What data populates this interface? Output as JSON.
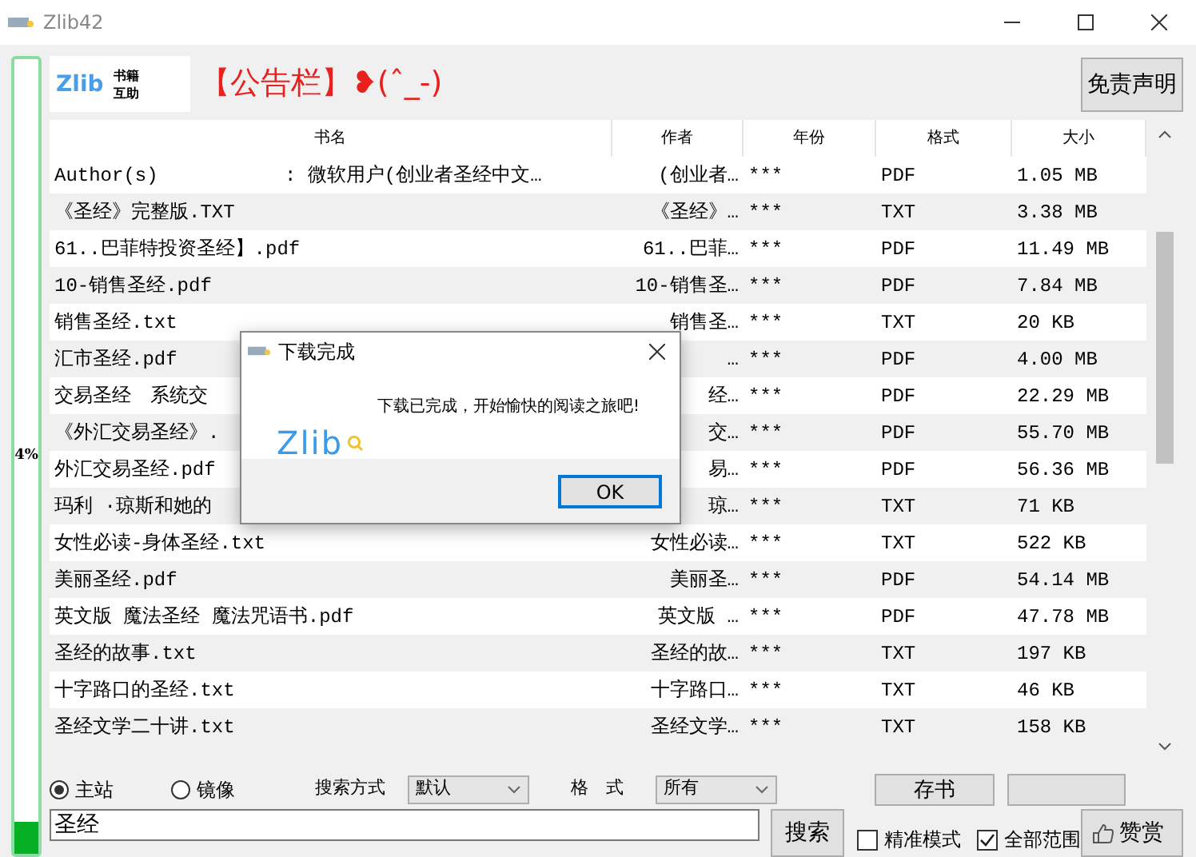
{
  "window": {
    "title": "Zlib42"
  },
  "progress": {
    "level": 0.04,
    "reading": "4%"
  },
  "logo": {
    "wordmark": "Zlib",
    "caption_lines": [
      "书籍",
      "互助"
    ]
  },
  "notice": "【公告栏】❥(ˆ_-)",
  "disclaimer_button": "免责声明",
  "table": {
    "columns": [
      "书名",
      "作者",
      "年份",
      "格式",
      "大小"
    ],
    "rows": [
      [
        "Author(s)           : 微软用户(创业者圣经中文…",
        "(创业者…",
        "***",
        "PDF",
        "1.05 MB"
      ],
      [
        "《圣经》完整版.TXT",
        "《圣经》…",
        "***",
        "TXT",
        "3.38 MB"
      ],
      [
        "61..巴菲特投资圣经】.pdf",
        "61..巴菲…",
        "***",
        "PDF",
        "11.49 MB"
      ],
      [
        "10-销售圣经.pdf",
        "10-销售圣…",
        "***",
        "PDF",
        "7.84 MB"
      ],
      [
        "销售圣经.txt",
        "销售圣…",
        "***",
        "TXT",
        "20 KB"
      ],
      [
        "汇市圣经.pdf",
        "…",
        "***",
        "PDF",
        "4.00 MB"
      ],
      [
        "交易圣经　系统交",
        "经…",
        "***",
        "PDF",
        "22.29 MB"
      ],
      [
        "《外汇交易圣经》.",
        "交…",
        "***",
        "PDF",
        "55.70 MB"
      ],
      [
        "外汇交易圣经.pdf",
        "易…",
        "***",
        "PDF",
        "56.36 MB"
      ],
      [
        "玛利 ·琼斯和她的",
        "琼…",
        "***",
        "TXT",
        "71 KB"
      ],
      [
        "女性必读-身体圣经.txt",
        "女性必读…",
        "***",
        "TXT",
        "522 KB"
      ],
      [
        "美丽圣经.pdf",
        "美丽圣…",
        "***",
        "PDF",
        "54.14 MB"
      ],
      [
        "英文版 魔法圣经 魔法咒语书.pdf",
        "英文版 …",
        "***",
        "PDF",
        "47.78 MB"
      ],
      [
        "圣经的故事.txt",
        "圣经的故…",
        "***",
        "TXT",
        "197 KB"
      ],
      [
        "十字路口的圣经.txt",
        "十字路口…",
        "***",
        "TXT",
        "46 KB"
      ],
      [
        "圣经文学二十讲.txt",
        "圣经文学…",
        "***",
        "TXT",
        "158 KB"
      ]
    ]
  },
  "source_options": [
    {
      "label": "主站",
      "selected": true
    },
    {
      "label": "镜像",
      "selected": false
    }
  ],
  "search_mode": {
    "label": "搜索方式",
    "value": "默认"
  },
  "format_filter": {
    "label": "格　式",
    "value": "所有"
  },
  "save_button": "存书",
  "query": {
    "value": "圣经"
  },
  "search_button": "搜索",
  "checkboxes": [
    {
      "label": "精准模式",
      "checked": false
    },
    {
      "label": "全部范围",
      "checked": true
    }
  ],
  "reward_button": "赞赏",
  "dialog": {
    "title": "下载完成",
    "wordmark": "Zlib",
    "message": "下载已完成，开始愉快的阅读之旅吧!",
    "ok_button": "OK"
  }
}
